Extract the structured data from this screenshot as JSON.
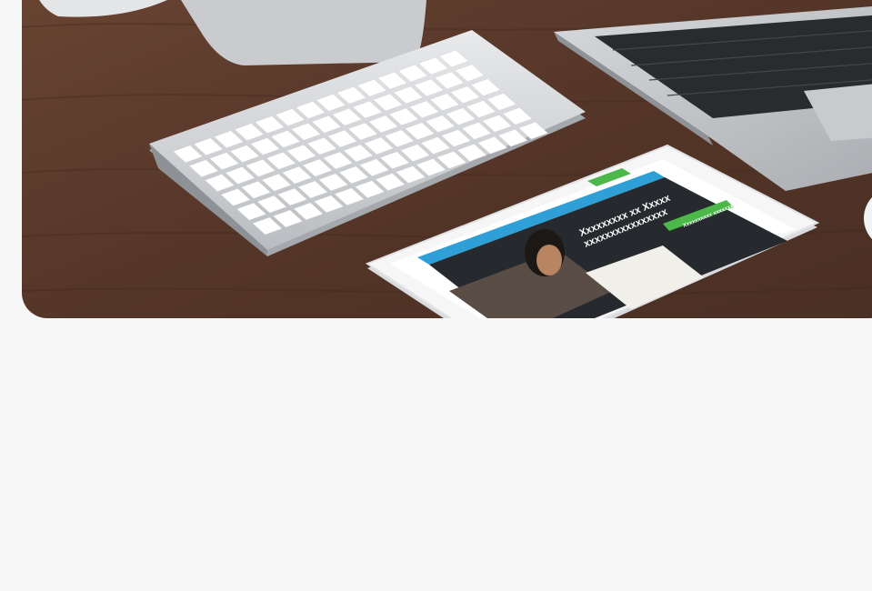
{
  "hero": {
    "headline_line1": "Xxxxxxxxx xx Xxxxx",
    "headline_line2": "xxxxxxxxxxxxxxxx",
    "cta_label": "Xxxxxxxxxx xxxxxxx"
  },
  "colors": {
    "page_background": "#f7f7f7",
    "desk_wood": "#5a3a2a",
    "tablet_header_green": "#4cb84a",
    "tablet_banner_blue": "#2f9fd8",
    "tablet_dark": "#262a2e"
  }
}
